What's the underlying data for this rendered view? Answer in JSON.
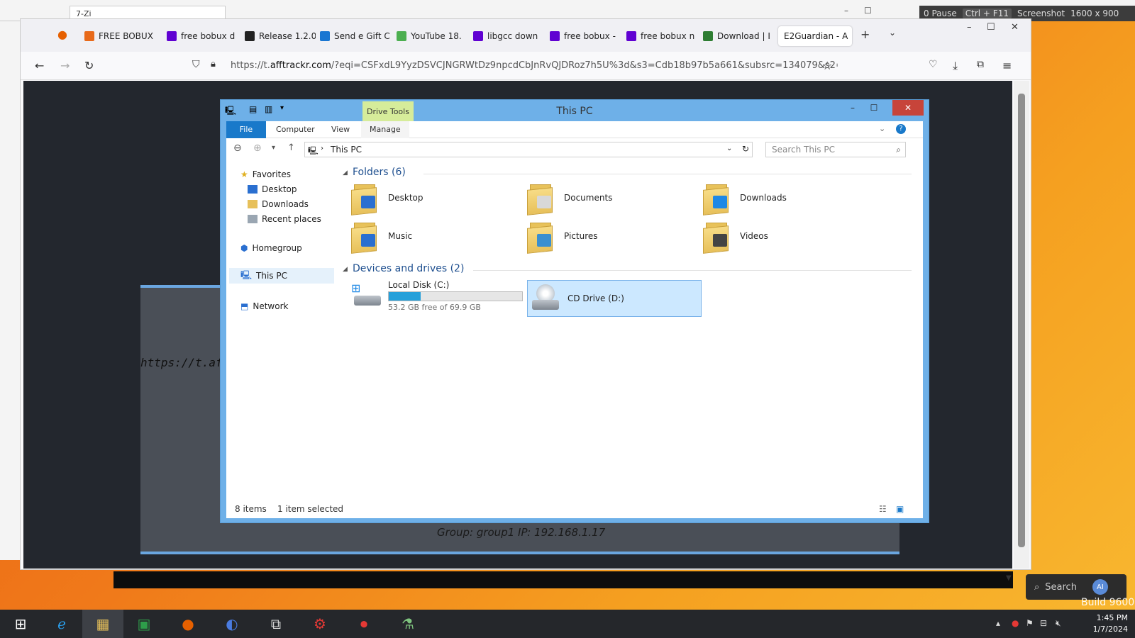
{
  "recorder": {
    "pause": "0 Pause",
    "shortcut": "Ctrl + F11",
    "screenshot": "Screenshot",
    "resolution": "1600 x 900"
  },
  "outer_tab": {
    "label": "7-Zi"
  },
  "browser": {
    "tabs": [
      {
        "label": "FREE BOBUX",
        "icon": "bobux-icon",
        "color": "#e86a1a"
      },
      {
        "label": "free bobux d",
        "icon": "yahoo-icon",
        "color": "#6001d2"
      },
      {
        "label": "Release 1.2.0",
        "icon": "github-icon",
        "color": "#222222"
      },
      {
        "label": "Send e Gift C",
        "icon": "t-icon",
        "color": "#1976d2"
      },
      {
        "label": "YouTube 18.",
        "icon": "youtube-icon",
        "color": "#4caf50"
      },
      {
        "label": "libgcc down",
        "icon": "yahoo-icon",
        "color": "#6001d2"
      },
      {
        "label": "free bobux -",
        "icon": "yahoo-icon",
        "color": "#6001d2"
      },
      {
        "label": "free bobux n",
        "icon": "yahoo-icon",
        "color": "#6001d2"
      },
      {
        "label": "Download | I",
        "icon": "download-icon",
        "color": "#2e7d32"
      },
      {
        "label": "E2Guardian - A",
        "icon": "",
        "color": "#ffffff"
      }
    ],
    "url_prefix": "https://t.",
    "url_domain": "afftrackr.com",
    "url_rest": "/?eqi=CSFxdL9YyzDSVCJNGRWtDz9npcdCbJnRvQJDRoz7h5U%3d&s3=Cdb18b97b5a661&subsrc=134079&s2="
  },
  "e2guardian": {
    "url_fragment": "https://t.afftr",
    "group_line": "Group: group1    IP: 192.168.1.17"
  },
  "explorer": {
    "title": "This PC",
    "drive_tools": "Drive Tools",
    "ribbon": {
      "file": "File",
      "computer": "Computer",
      "view": "View",
      "manage": "Manage"
    },
    "address": "This PC",
    "search_placeholder": "Search This PC",
    "nav": {
      "favorites": "Favorites",
      "desktop": "Desktop",
      "downloads": "Downloads",
      "recent": "Recent places",
      "homegroup": "Homegroup",
      "thispc": "This PC",
      "network": "Network"
    },
    "folders_header": "Folders (6)",
    "folders": [
      {
        "name": "Desktop",
        "badge": "#2a6fd0"
      },
      {
        "name": "Documents",
        "badge": "#d8d8d8"
      },
      {
        "name": "Downloads",
        "badge": "#1e88e5"
      },
      {
        "name": "Music",
        "badge": "#2a6fd0"
      },
      {
        "name": "Pictures",
        "badge": "#3a8fd0"
      },
      {
        "name": "Videos",
        "badge": "#444444"
      }
    ],
    "devices_header": "Devices and drives (2)",
    "local_disk": {
      "name": "Local Disk (C:)",
      "free": "53.2 GB free of 69.9 GB",
      "used_fraction": 0.24
    },
    "cd_drive": {
      "name": "CD Drive (D:)"
    },
    "status_items": "8 items",
    "status_selected": "1 item selected"
  },
  "taskbar": {
    "search": "Search",
    "build": "Build 9600",
    "time": "1:45 PM",
    "date": "1/7/2024"
  }
}
